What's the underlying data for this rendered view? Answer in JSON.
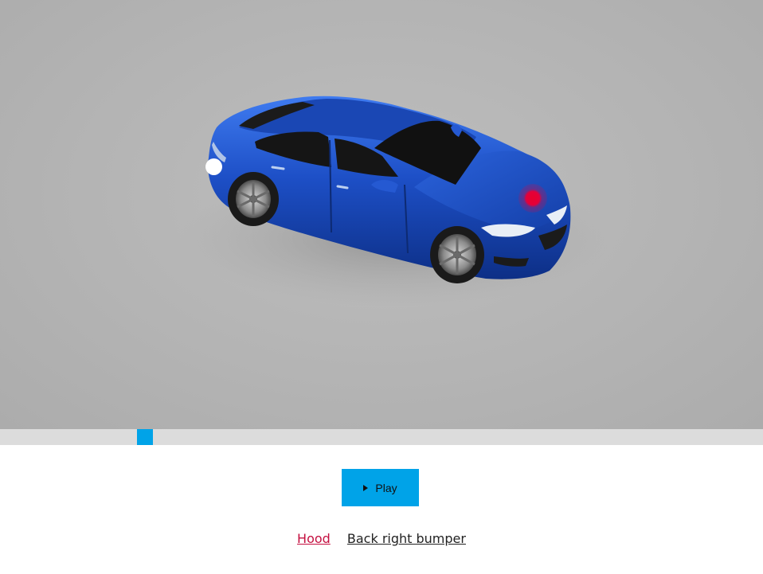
{
  "viewer": {
    "background_color": "#b4b4b4",
    "car_color": "#1a4fc4",
    "hotspots": [
      {
        "name": "Hood",
        "color": "#e4003a",
        "active": true
      },
      {
        "name": "Back right bumper",
        "color": "#ffffff",
        "active": false
      }
    ]
  },
  "timeline": {
    "track_color": "#dcdcdc",
    "thumb_color": "#00a3e8",
    "progress": 0.18
  },
  "controls": {
    "play_label": "Play",
    "play_icon": "play-triangle-icon",
    "accent_color": "#00a3e8"
  },
  "links": [
    {
      "label": "Hood",
      "color": "#c41040"
    },
    {
      "label": "Back right bumper",
      "color": "#222222"
    }
  ]
}
